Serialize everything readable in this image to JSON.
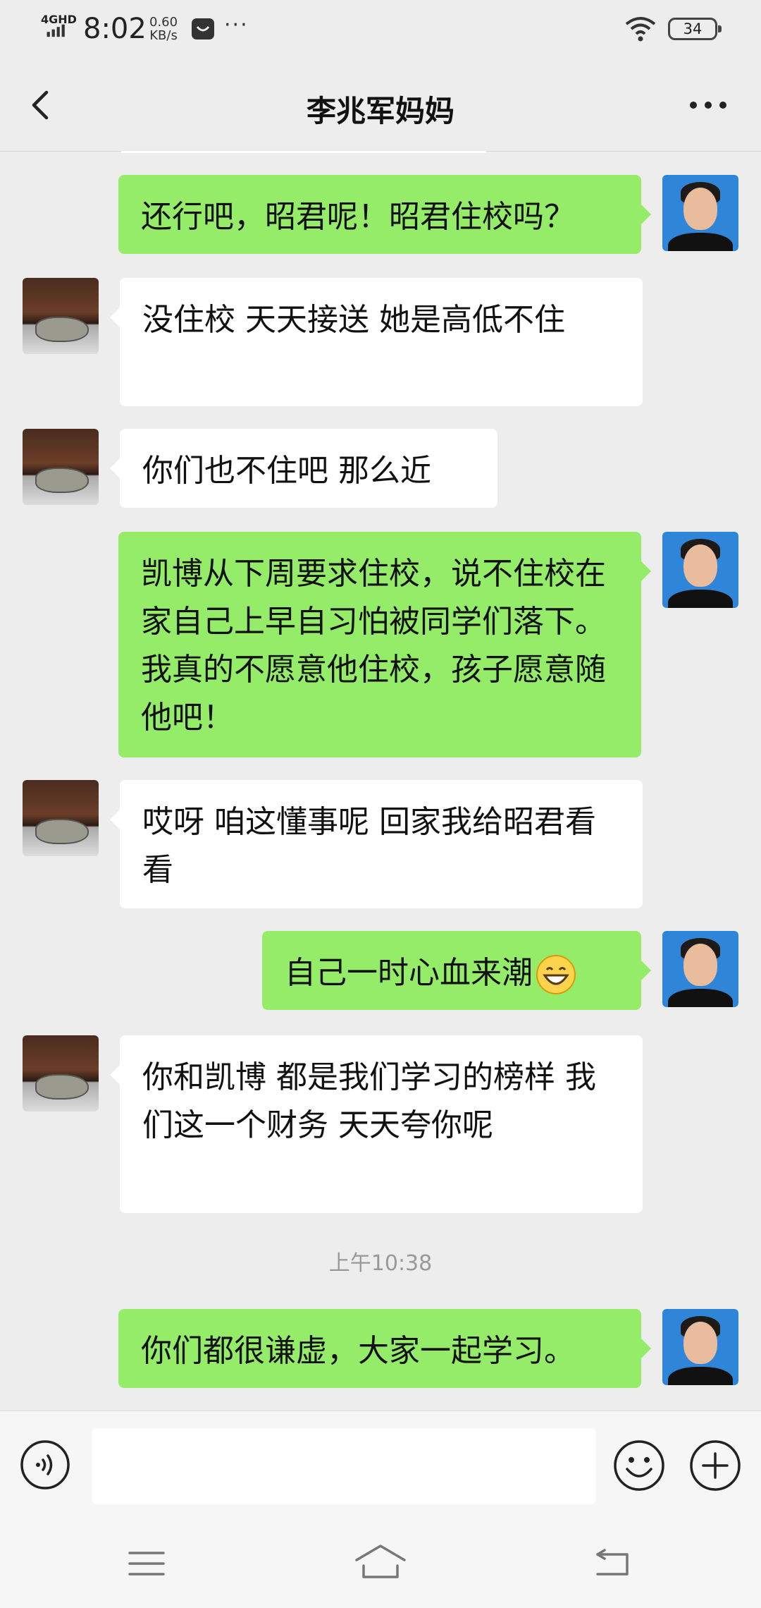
{
  "status_bar": {
    "network": "4GHD",
    "time": "8:02",
    "speed_value": "0.60",
    "speed_unit": "KB/s",
    "more": "···",
    "battery": "34"
  },
  "header": {
    "title": "李兆军妈妈"
  },
  "messages": [
    {
      "from": "self",
      "text": "还行吧，昭君呢！昭君住校吗？"
    },
    {
      "from": "other",
      "text": "没住校  天天接送   她是高低不住"
    },
    {
      "from": "other",
      "text": "你们也不住吧 那么近"
    },
    {
      "from": "self",
      "text": "凯博从下周要求住校，说不住校在家自己上早自习怕被同学们落下。我真的不愿意他住校，孩子愿意随他吧！"
    },
    {
      "from": "other",
      "text": "哎呀  咱这懂事呢  回家我给昭君看看"
    },
    {
      "from": "self",
      "text": "自己一时心血来潮",
      "emoji": "grinning-face"
    },
    {
      "from": "other",
      "text": "你和凯博 都是我们学习的榜样  我们这一个财务 天天夸你呢"
    },
    {
      "timestamp": "上午10:38"
    },
    {
      "from": "self",
      "text": "你们都很谦虚，大家一起学习。"
    }
  ],
  "input_bar": {
    "value": ""
  },
  "colors": {
    "outgoing_bubble": "#95ec69",
    "incoming_bubble": "#ffffff",
    "background": "#ededed"
  }
}
